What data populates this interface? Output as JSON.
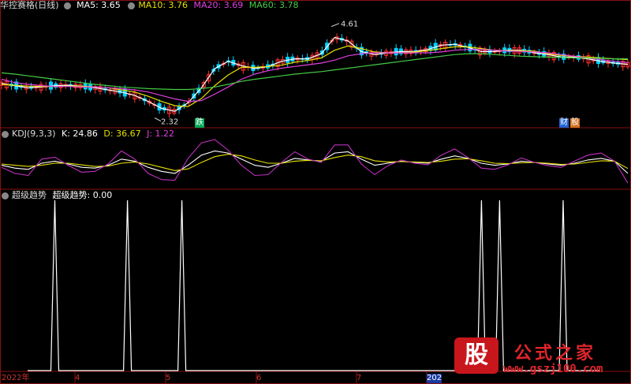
{
  "main": {
    "title": "华控赛格(日线)",
    "ma_labels": [
      {
        "text": "MA5: 3.65",
        "color": "#ffffff"
      },
      {
        "text": "MA10: 3.76",
        "color": "#e8e000"
      },
      {
        "text": "MA20: 3.69",
        "color": "#e040e0"
      },
      {
        "text": "MA60: 3.78",
        "color": "#44cc44"
      }
    ],
    "high_label": "4.61",
    "low_label": "2.32",
    "tag_die": "跌",
    "tag_cai": "财",
    "tag_gu": "股"
  },
  "kdj": {
    "title": "KDJ(9,3,3)",
    "k_label": "K: 24.86",
    "d_label": "D: 36.67",
    "j_label": "J: 1.22"
  },
  "indicator": {
    "title": "超级趋势",
    "value_label": "超级趋势: 0.00"
  },
  "x_axis": {
    "labels": [
      "2022年",
      "4",
      "5",
      "6",
      "7",
      "202"
    ]
  },
  "watermark": {
    "badge": "股",
    "name": "公式之家",
    "url": "www.gszj100.com"
  },
  "colors": {
    "up": "#ff3030",
    "down": "#00d0ff",
    "ma5": "#ffffff",
    "ma10": "#e8e000",
    "ma20": "#e040e0",
    "ma60": "#44cc44",
    "k": "#ffffff",
    "d": "#e8e000",
    "j": "#c030c0",
    "grid": "#8a1010"
  },
  "chart_data": [
    {
      "type": "candlestick",
      "title": "华控赛格(日线)",
      "ylim": [
        2.2,
        4.9
      ],
      "annotations": [
        {
          "label": "4.61",
          "value": 4.61
        },
        {
          "label": "2.32",
          "value": 2.32
        }
      ],
      "series": [
        {
          "name": "MA5",
          "values": [
            3.2,
            3.15,
            3.1,
            3.12,
            3.15,
            3.16,
            3.14,
            3.1,
            3.05,
            3.0,
            2.92,
            2.78,
            2.62,
            2.55,
            2.75,
            3.1,
            3.55,
            3.72,
            3.62,
            3.55,
            3.6,
            3.72,
            3.78,
            3.78,
            3.9,
            4.28,
            4.2,
            3.95,
            3.88,
            3.92,
            3.95,
            3.95,
            4.0,
            4.1,
            4.12,
            4.05,
            3.95,
            3.95,
            3.98,
            3.98,
            3.92,
            3.88,
            3.82,
            3.82,
            3.78,
            3.72,
            3.68,
            3.65
          ]
        },
        {
          "name": "MA10",
          "values": [
            3.18,
            3.16,
            3.14,
            3.13,
            3.13,
            3.14,
            3.14,
            3.12,
            3.1,
            3.05,
            3.0,
            2.9,
            2.78,
            2.68,
            2.66,
            2.85,
            3.15,
            3.4,
            3.58,
            3.58,
            3.6,
            3.63,
            3.7,
            3.74,
            3.8,
            3.98,
            4.08,
            4.02,
            3.94,
            3.92,
            3.92,
            3.94,
            3.97,
            4.02,
            4.06,
            4.06,
            4.02,
            3.98,
            3.97,
            3.97,
            3.96,
            3.9,
            3.86,
            3.84,
            3.82,
            3.8,
            3.78,
            3.76
          ]
        },
        {
          "name": "MA20",
          "values": [
            3.3,
            3.22,
            3.18,
            3.15,
            3.13,
            3.13,
            3.12,
            3.12,
            3.1,
            3.08,
            3.05,
            3.0,
            2.92,
            2.84,
            2.78,
            2.8,
            2.95,
            3.12,
            3.3,
            3.42,
            3.5,
            3.56,
            3.6,
            3.64,
            3.68,
            3.75,
            3.85,
            3.9,
            3.92,
            3.92,
            3.92,
            3.92,
            3.92,
            3.94,
            3.98,
            4.0,
            4.0,
            3.98,
            3.96,
            3.95,
            3.94,
            3.92,
            3.88,
            3.84,
            3.8,
            3.76,
            3.72,
            3.69
          ]
        },
        {
          "name": "MA60",
          "values": [
            3.45,
            3.42,
            3.38,
            3.34,
            3.3,
            3.26,
            3.22,
            3.18,
            3.15,
            3.12,
            3.1,
            3.08,
            3.07,
            3.06,
            3.06,
            3.08,
            3.12,
            3.18,
            3.25,
            3.3,
            3.34,
            3.38,
            3.42,
            3.45,
            3.48,
            3.52,
            3.56,
            3.6,
            3.64,
            3.68,
            3.72,
            3.76,
            3.8,
            3.84,
            3.88,
            3.9,
            3.9,
            3.88,
            3.86,
            3.84,
            3.83,
            3.82,
            3.81,
            3.8,
            3.8,
            3.79,
            3.78,
            3.78
          ]
        }
      ]
    },
    {
      "type": "line",
      "title": "KDJ(9,3,3)",
      "ylim": [
        -10,
        110
      ],
      "series": [
        {
          "name": "K",
          "values": [
            45,
            38,
            35,
            50,
            55,
            48,
            40,
            38,
            45,
            60,
            55,
            40,
            30,
            25,
            45,
            70,
            80,
            75,
            60,
            45,
            40,
            50,
            62,
            58,
            55,
            75,
            78,
            60,
            45,
            50,
            55,
            52,
            50,
            60,
            68,
            62,
            50,
            45,
            48,
            55,
            52,
            48,
            45,
            50,
            58,
            62,
            55,
            25
          ]
        },
        {
          "name": "D",
          "values": [
            48,
            45,
            42,
            45,
            50,
            50,
            46,
            42,
            43,
            50,
            53,
            48,
            40,
            32,
            36,
            52,
            66,
            72,
            68,
            58,
            50,
            50,
            55,
            57,
            56,
            64,
            70,
            66,
            56,
            53,
            54,
            53,
            52,
            55,
            60,
            61,
            56,
            50,
            49,
            51,
            52,
            50,
            47,
            48,
            52,
            56,
            55,
            37
          ]
        },
        {
          "name": "J",
          "values": [
            40,
            25,
            20,
            60,
            65,
            45,
            28,
            30,
            48,
            80,
            60,
            25,
            10,
            8,
            62,
            100,
            108,
            82,
            45,
            20,
            22,
            52,
            78,
            60,
            52,
            95,
            95,
            48,
            22,
            44,
            58,
            50,
            46,
            70,
            85,
            64,
            38,
            35,
            46,
            63,
            52,
            44,
            40,
            55,
            70,
            75,
            55,
            1
          ]
        }
      ]
    },
    {
      "type": "line",
      "title": "超级趋势",
      "ylim": [
        0,
        1
      ],
      "series": [
        {
          "name": "超级趋势",
          "values": [
            0,
            0,
            0,
            1,
            0,
            0,
            0,
            0,
            0,
            0,
            0,
            1,
            0,
            0,
            0,
            0,
            0,
            1,
            0,
            0,
            0,
            0,
            0,
            0,
            0,
            0,
            0,
            0,
            0,
            0,
            0,
            0,
            0,
            0,
            0,
            0,
            0,
            0,
            0,
            0,
            0,
            0,
            0,
            0,
            0,
            0,
            0,
            0,
            0,
            0,
            1,
            0,
            1,
            0,
            0,
            0,
            0,
            0,
            0,
            1,
            0,
            0,
            0,
            0
          ]
        }
      ]
    }
  ]
}
